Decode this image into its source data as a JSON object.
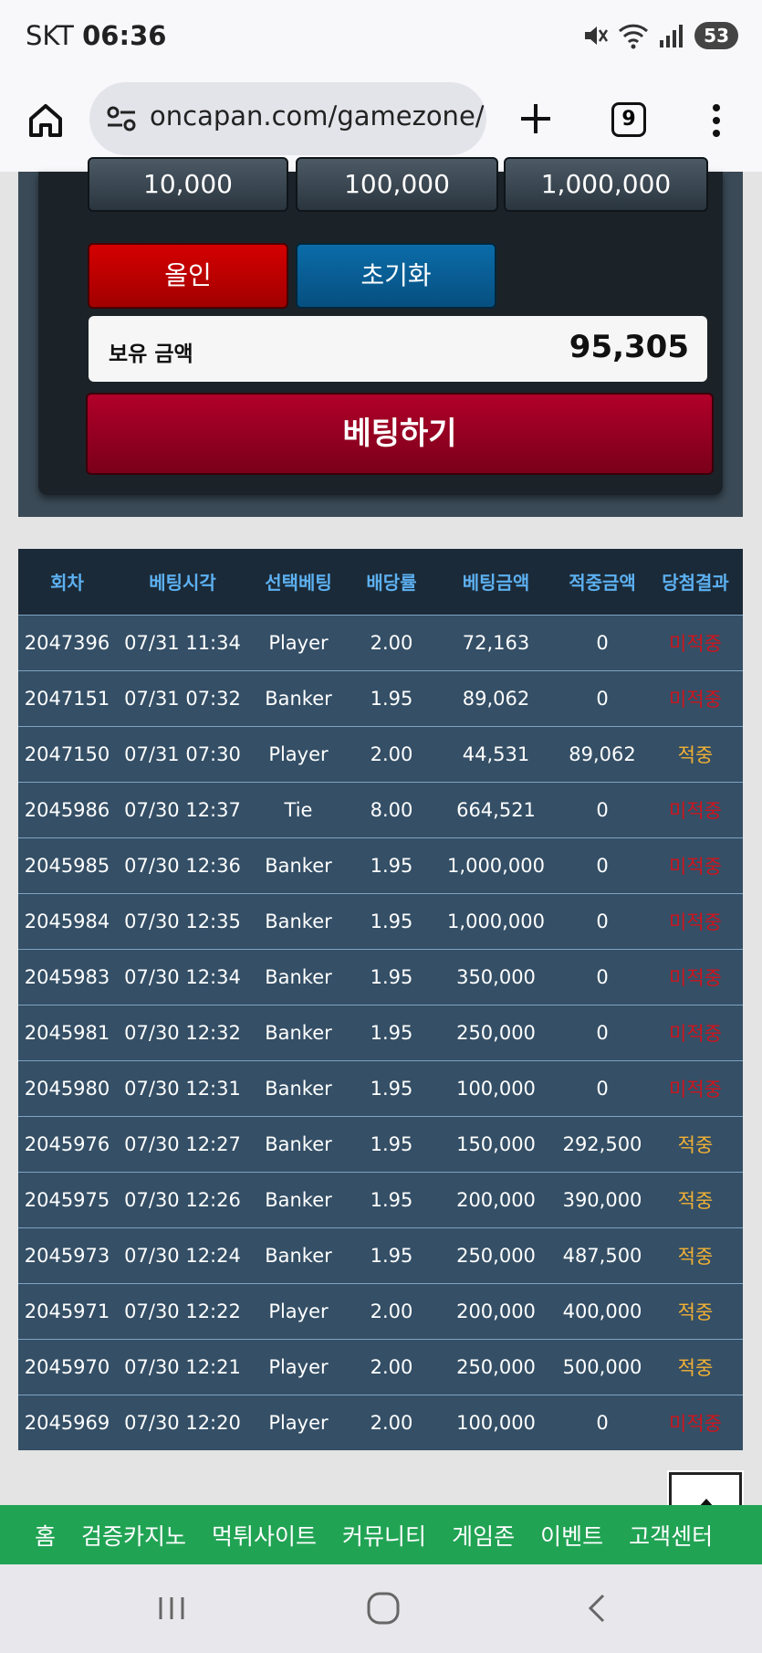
{
  "status_bar": {
    "carrier": "SKT",
    "time": "06:36",
    "battery": "53"
  },
  "browser": {
    "url": "oncapan.com/gamezone/ba",
    "tab_count": "9"
  },
  "panel": {
    "chips": [
      "10,000",
      "100,000",
      "1,000,000"
    ],
    "allin_label": "올인",
    "reset_label": "초기화",
    "balance_label": "보유 금액",
    "balance_value": "95,305",
    "bet_label": "베팅하기"
  },
  "table": {
    "headers": [
      "회차",
      "베팅시각",
      "선택베팅",
      "배당률",
      "베팅금액",
      "적중금액",
      "당첨결과"
    ],
    "rows": [
      [
        "2047396",
        "07/31 11:34",
        "Player",
        "2.00",
        "72,163",
        "0",
        "미적중"
      ],
      [
        "2047151",
        "07/31 07:32",
        "Banker",
        "1.95",
        "89,062",
        "0",
        "미적중"
      ],
      [
        "2047150",
        "07/31 07:30",
        "Player",
        "2.00",
        "44,531",
        "89,062",
        "적중"
      ],
      [
        "2045986",
        "07/30 12:37",
        "Tie",
        "8.00",
        "664,521",
        "0",
        "미적중"
      ],
      [
        "2045985",
        "07/30 12:36",
        "Banker",
        "1.95",
        "1,000,000",
        "0",
        "미적중"
      ],
      [
        "2045984",
        "07/30 12:35",
        "Banker",
        "1.95",
        "1,000,000",
        "0",
        "미적중"
      ],
      [
        "2045983",
        "07/30 12:34",
        "Banker",
        "1.95",
        "350,000",
        "0",
        "미적중"
      ],
      [
        "2045981",
        "07/30 12:32",
        "Banker",
        "1.95",
        "250,000",
        "0",
        "미적중"
      ],
      [
        "2045980",
        "07/30 12:31",
        "Banker",
        "1.95",
        "100,000",
        "0",
        "미적중"
      ],
      [
        "2045976",
        "07/30 12:27",
        "Banker",
        "1.95",
        "150,000",
        "292,500",
        "적중"
      ],
      [
        "2045975",
        "07/30 12:26",
        "Banker",
        "1.95",
        "200,000",
        "390,000",
        "적중"
      ],
      [
        "2045973",
        "07/30 12:24",
        "Banker",
        "1.95",
        "250,000",
        "487,500",
        "적중"
      ],
      [
        "2045971",
        "07/30 12:22",
        "Player",
        "2.00",
        "200,000",
        "400,000",
        "적중"
      ],
      [
        "2045970",
        "07/30 12:21",
        "Player",
        "2.00",
        "250,000",
        "500,000",
        "적중"
      ],
      [
        "2045969",
        "07/30 12:20",
        "Player",
        "2.00",
        "100,000",
        "0",
        "미적중"
      ]
    ]
  },
  "site_nav": [
    "홈",
    "검증카지노",
    "먹튀사이트",
    "커뮤니티",
    "게임존",
    "이벤트",
    "고객센터"
  ],
  "colors": {
    "win": "#f2b134",
    "lose": "#d0141c",
    "nav_green": "#21a354",
    "bet_red": "#b1002a"
  },
  "icons": [
    "home-icon",
    "tune-icon",
    "plus-icon",
    "menu-icon",
    "arrow-up-icon",
    "recents-icon",
    "home-circle-icon",
    "back-icon"
  ]
}
